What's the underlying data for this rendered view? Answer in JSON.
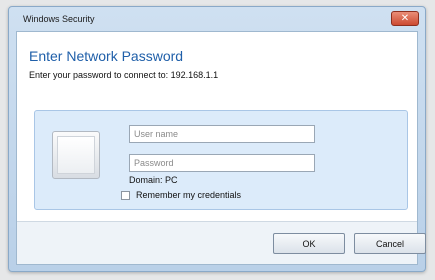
{
  "window": {
    "title": "Windows Security",
    "close_glyph": "✕"
  },
  "dialog": {
    "heading": "Enter Network Password",
    "subtext": "Enter your password to connect to: 192.168.1.1",
    "username_placeholder": "User name",
    "password_placeholder": "Password",
    "domain_label": "Domain: PC",
    "remember_label": "Remember my credentials"
  },
  "buttons": {
    "ok": "OK",
    "cancel": "Cancel"
  },
  "icons": {
    "user_tile": "user-tile-icon",
    "close": "close-icon"
  },
  "colors": {
    "heading": "#1f5fa9",
    "title_gradient_top": "#cfe0f1",
    "title_gradient_bottom": "#b9d0e8",
    "panel": "#dcebfa",
    "close_button": "#cc4a31"
  }
}
